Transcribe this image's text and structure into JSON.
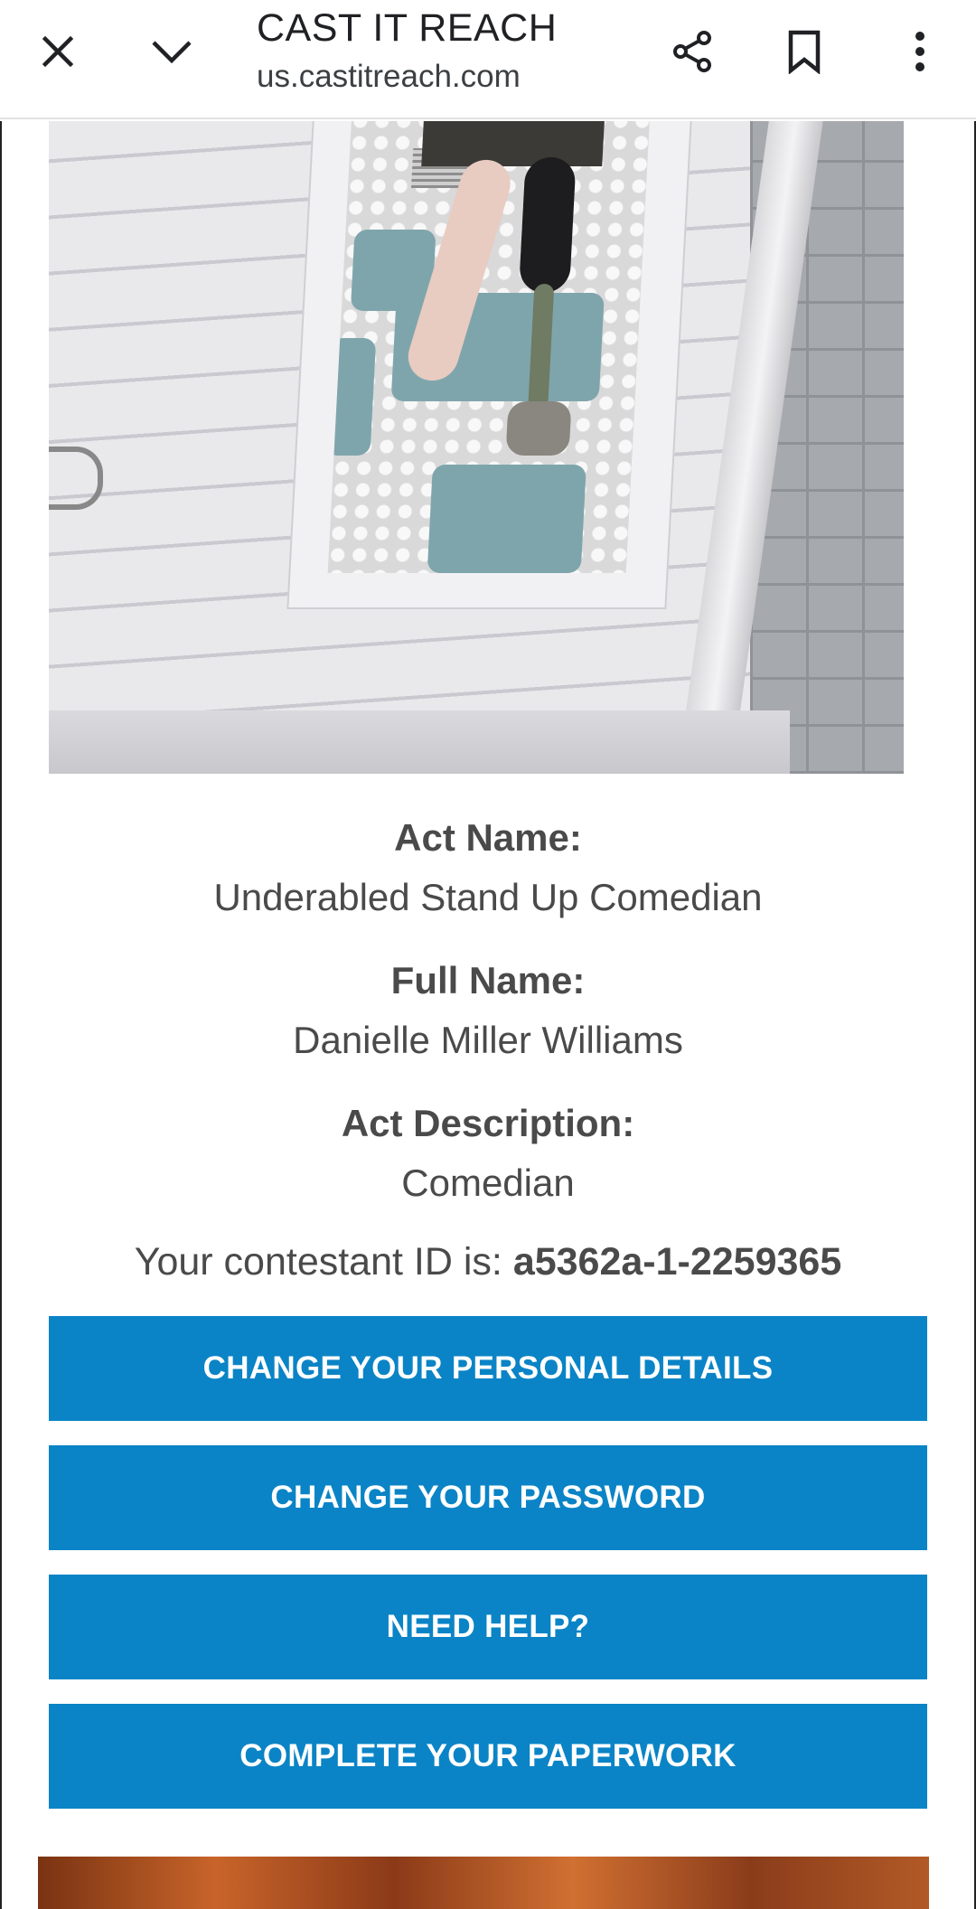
{
  "browser": {
    "title": "CAST IT REACH",
    "url": "us.castitreach.com",
    "icons": {
      "close": "close-icon",
      "collapse": "chevron-down-icon",
      "share": "share-icon",
      "bookmark": "bookmark-icon",
      "menu": "more-vert-icon"
    }
  },
  "profile": {
    "act_name_label": "Act Name:",
    "act_name": "Underabled Stand Up Comedian",
    "full_name_label": "Full Name:",
    "full_name": "Danielle Miller Williams",
    "act_description_label": "Act Description:",
    "act_description": "Comedian",
    "contestant_prefix": "Your contestant ID is: ",
    "contestant_id": "a5362a-1-2259365"
  },
  "actions": {
    "personal_details": "CHANGE YOUR PERSONAL DETAILS",
    "password": "CHANGE YOUR PASSWORD",
    "help": "NEED HELP?",
    "paperwork": "COMPLETE YOUR PAPERWORK"
  },
  "colors": {
    "button": "#0a84c6",
    "text": "#4a4a4a"
  }
}
